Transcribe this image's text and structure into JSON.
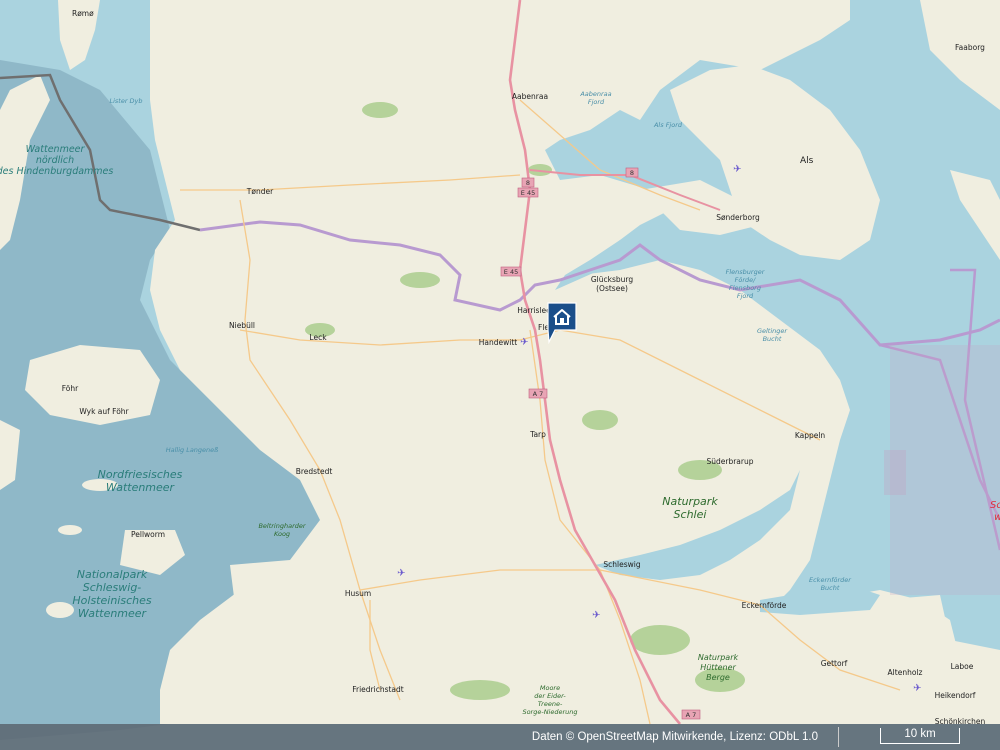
{
  "map": {
    "provider": "OpenStreetMap",
    "colors": {
      "land": "#f0eee0",
      "water": "#aad3df",
      "wadden": "#6f9fb0",
      "forest": "#b5d29a",
      "motorway": "#e892a2",
      "border": "#a98bc2",
      "national_border": "#6f6f6f"
    },
    "towns": [
      {
        "name": "Rømø"
      },
      {
        "name": "Aabenraa"
      },
      {
        "name": "Tønder"
      },
      {
        "name": "Sønderborg"
      },
      {
        "name": "Als"
      },
      {
        "name": "Faaborg"
      },
      {
        "name": "Glücksburg\n(Ostsee)"
      },
      {
        "name": "Harrislee"
      },
      {
        "name": "Fle"
      },
      {
        "name": "Handewitt"
      },
      {
        "name": "Niebüll"
      },
      {
        "name": "Leck"
      },
      {
        "name": "Wyk auf Föhr"
      },
      {
        "name": "Föhr"
      },
      {
        "name": "Tarp"
      },
      {
        "name": "Kappeln"
      },
      {
        "name": "Süderbrarup"
      },
      {
        "name": "Bredstedt"
      },
      {
        "name": "Schleswig"
      },
      {
        "name": "Husum"
      },
      {
        "name": "Pellworm"
      },
      {
        "name": "Eckernförde"
      },
      {
        "name": "Gettorf"
      },
      {
        "name": "Friedrichstadt"
      },
      {
        "name": "Altenholz"
      },
      {
        "name": "Laboe"
      },
      {
        "name": "Heikendorf"
      },
      {
        "name": "Schönkirchen"
      }
    ],
    "water_labels": [
      "Wattenmeer\nnördlich\ndes Hindenburgdammes",
      "Nordfriesisches\nWattenmeer",
      "Nationalpark\nSchleswig-\nHolsteinisches\nWattenmeer",
      "Flensburger\nFörde/\nFlensborg\nFjord",
      "Geltinger\nBucht",
      "Eckernförder\nBucht",
      "Lister Dyb",
      "Aabenraa\nFjord",
      "Als Fjord",
      "Eckernförder\nBucht"
    ],
    "parks": [
      "Naturpark\nSchlei",
      "Naturpark\nHüttener\nBerge",
      "Moore\nder Eider-\nTreene-\nSorge-Niederung",
      "Beltringharder\nKoog",
      "Hallig Langeneß"
    ],
    "road_shields": [
      "8",
      "E 45",
      "8",
      "E 45",
      "A 7",
      "A 7"
    ],
    "partial_label": "Sch\nw\n("
  },
  "footer": {
    "attribution": "Daten © OpenStreetMap Mitwirkende, Lizenz: ODbL 1.0",
    "scale": "10 km"
  },
  "marker": {
    "icon": "home-icon",
    "color": "#1a4e8a"
  }
}
